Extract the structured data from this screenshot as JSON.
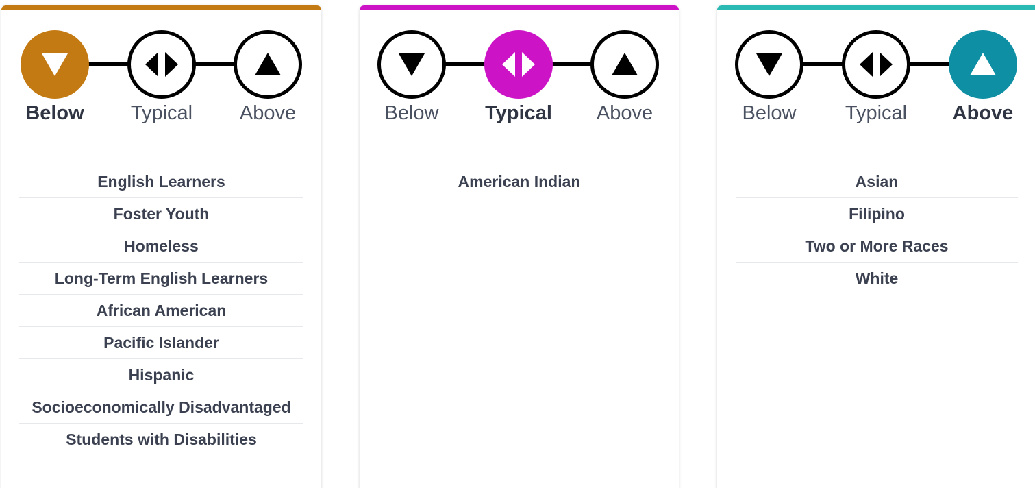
{
  "legend_labels": [
    "Below",
    "Typical",
    "Above"
  ],
  "cards": [
    {
      "status": "Below",
      "accent": "#c47a12",
      "active_index": 0,
      "groups": [
        "English Learners",
        "Foster Youth",
        "Homeless",
        "Long-Term English Learners",
        "African American",
        "Pacific Islander",
        "Hispanic",
        "Socioeconomically Disadvantaged",
        "Students with Disabilities"
      ]
    },
    {
      "status": "Typical",
      "accent": "#cc14c6",
      "active_index": 1,
      "groups": [
        "American Indian"
      ]
    },
    {
      "status": "Above",
      "accent": "#0e8fa4",
      "top_bar_color": "#2bb9b4",
      "active_index": 2,
      "groups": [
        "Asian",
        "Filipino",
        "Two or More Races",
        "White"
      ]
    }
  ],
  "icons": [
    "triangle-down-icon",
    "double-arrow-icon",
    "triangle-up-icon"
  ]
}
